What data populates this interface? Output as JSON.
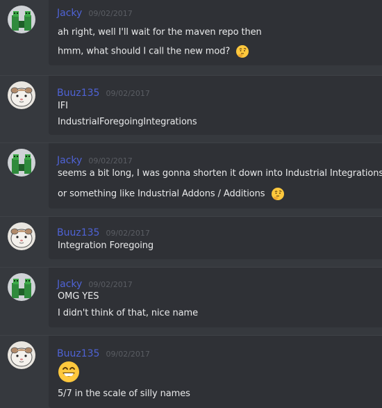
{
  "messages": [
    {
      "author": "Jacky",
      "timestamp": "09/02/2017",
      "avatar": "creeper-avatar",
      "lines": [
        {
          "text": "ah right, well I'll wait for the maven repo then"
        },
        {
          "text": "hmm, what should I call the new mod?",
          "emoji": "thinking-face"
        }
      ]
    },
    {
      "author": "Buuz135",
      "timestamp": "09/02/2017",
      "avatar": "hamster-avatar",
      "lines": [
        {
          "text": "IFI"
        },
        {
          "text": "IndustrialForegoingIntegrations"
        }
      ]
    },
    {
      "author": "Jacky",
      "timestamp": "09/02/2017",
      "avatar": "creeper-avatar",
      "lines": [
        {
          "text": "seems a bit long, I was gonna shorten it down into Industrial Integrations"
        },
        {
          "text": "or something like Industrial Addons / Additions",
          "emoji": "thinking-face"
        }
      ]
    },
    {
      "author": "Buuz135",
      "timestamp": "09/02/2017",
      "avatar": "hamster-avatar",
      "lines": [
        {
          "text": "Integration Foregoing"
        }
      ]
    },
    {
      "author": "Jacky",
      "timestamp": "09/02/2017",
      "avatar": "creeper-avatar",
      "lines": [
        {
          "text": "OMG YES"
        },
        {
          "text": "I didn't think of that, nice name"
        }
      ]
    },
    {
      "author": "Buuz135",
      "timestamp": "09/02/2017",
      "avatar": "hamster-avatar",
      "big_emoji": "grinning-face",
      "lines": [
        {
          "text": "5/7 in the scale of silly names"
        }
      ]
    }
  ],
  "colors": {
    "background": "#36393e",
    "message_box": "#2f3136",
    "username": "#4f63d6",
    "timestamp": "#5a5d63",
    "text": "#e9eaeb"
  }
}
